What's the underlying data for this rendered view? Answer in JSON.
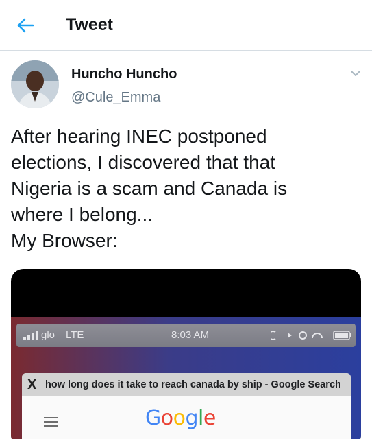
{
  "header": {
    "title": "Tweet",
    "back_icon": "arrow-left-icon",
    "accent": "#1da1f2"
  },
  "author": {
    "name": "Huncho Huncho",
    "handle": "@Cule_Emma"
  },
  "tweet": {
    "lines": [
      "After hearing INEC postponed",
      "elections, I discovered that that",
      "Nigeria is a scam and Canada is",
      "where I belong...",
      "My Browser:"
    ]
  },
  "media": {
    "status_bar": {
      "carrier": "glo",
      "network": "LTE",
      "time": "8:03 AM"
    },
    "tab_title": "how long does it take to reach canada by ship - Google Search",
    "close_glyph": "X",
    "logo": {
      "letters": [
        "G",
        "o",
        "o",
        "g",
        "l",
        "e"
      ],
      "colors": [
        "#4285f4",
        "#ea4335",
        "#fbbc05",
        "#4285f4",
        "#34a853",
        "#ea4335"
      ]
    }
  }
}
